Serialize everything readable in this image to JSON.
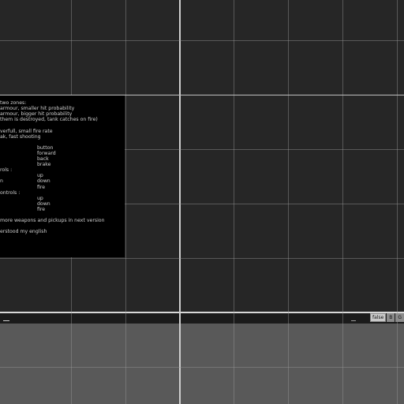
{
  "instructions": {
    "lines": [
      {
        "text": "two zones:"
      },
      {
        "text": "armour, smaller hit probability"
      },
      {
        "text": "armour, bigger hit probability"
      },
      {
        "text": "them is destroyed, tank catches on fire)"
      },
      {
        "text": ""
      },
      {
        "text": "verfull, small fire rate"
      },
      {
        "text": "ak, fast shooting"
      },
      {
        "text": ""
      },
      {
        "key": "",
        "action": "button"
      },
      {
        "key": "",
        "action": "forward"
      },
      {
        "key": "",
        "action": "back"
      },
      {
        "key": "",
        "action": "brake"
      },
      {
        "text": "rols :"
      },
      {
        "key": "",
        "action": "up"
      },
      {
        "key": "n",
        "action": "down"
      },
      {
        "key": "",
        "action": "fire"
      },
      {
        "text": "ontrols :"
      },
      {
        "key": "",
        "action": "up"
      },
      {
        "key": "",
        "action": "down"
      },
      {
        "key": "",
        "action": "fire"
      },
      {
        "text": ""
      },
      {
        "text": "more weapons and pickups in next version"
      },
      {
        "text": ""
      },
      {
        "text": "erstood my english"
      }
    ]
  },
  "toolbar": {
    "toggle_false": "false",
    "toggle_b": "B",
    "toggle_g": "G"
  }
}
